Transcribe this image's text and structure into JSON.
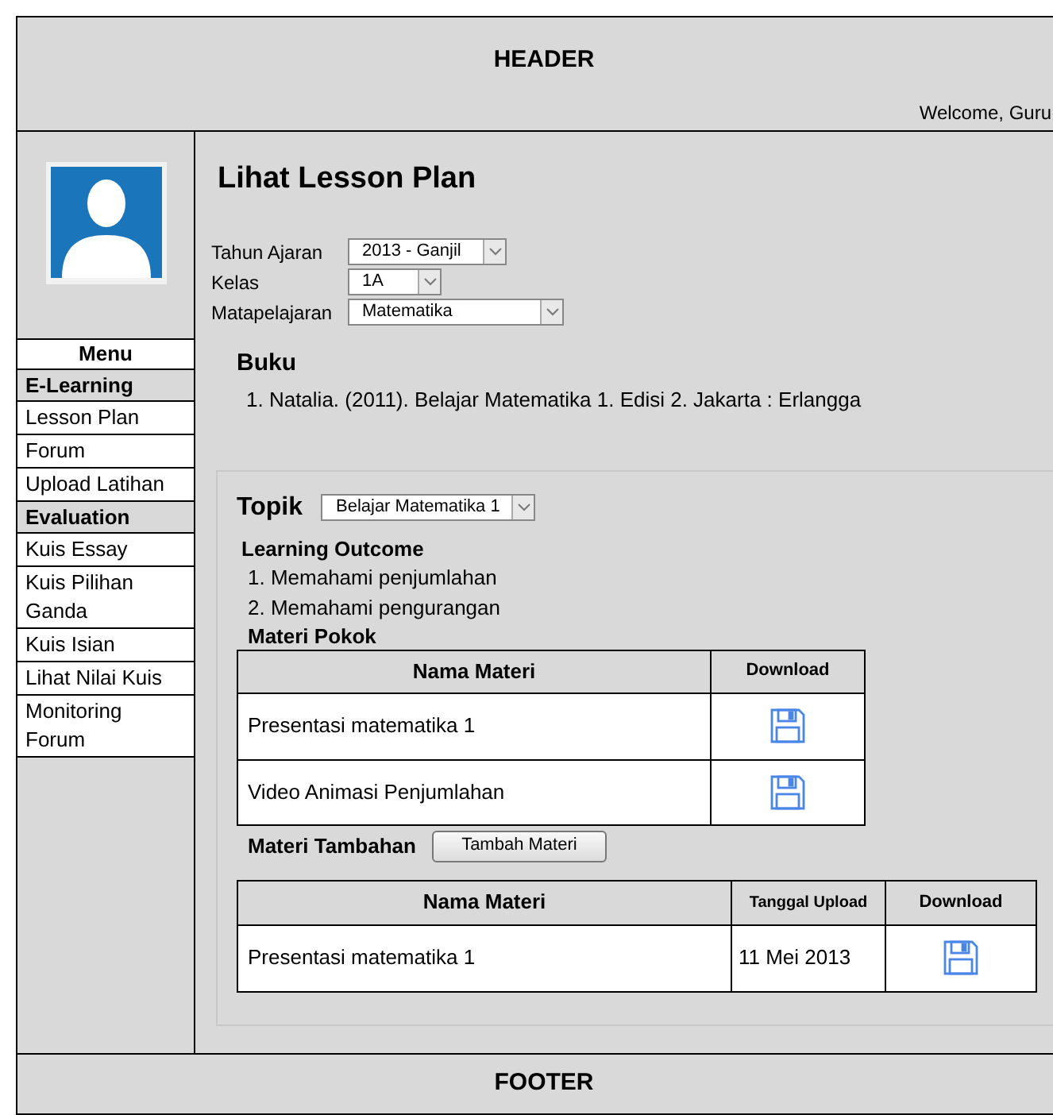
{
  "header": {
    "title": "HEADER",
    "welcome": "Welcome, Guru"
  },
  "sidebar": {
    "menu_title": "Menu",
    "items": [
      {
        "kind": "section",
        "label": "E-Learning"
      },
      {
        "kind": "link",
        "label": "Lesson Plan"
      },
      {
        "kind": "link",
        "label": "Forum"
      },
      {
        "kind": "link",
        "label": "Upload Latihan"
      },
      {
        "kind": "section",
        "label": "Evaluation"
      },
      {
        "kind": "link",
        "label": "Kuis Essay"
      },
      {
        "kind": "link",
        "label": "Kuis Pilihan Ganda"
      },
      {
        "kind": "link",
        "label": "Kuis Isian"
      },
      {
        "kind": "link",
        "label": "Lihat Nilai Kuis"
      },
      {
        "kind": "link",
        "label": "Monitoring Forum"
      }
    ]
  },
  "page_title": "Lihat Lesson Plan",
  "filters": [
    {
      "label": "Tahun Ajaran",
      "value": "2013 - Ganjil"
    },
    {
      "label": "Kelas",
      "value": "1A"
    },
    {
      "label": "Matapelajaran",
      "value": "Matematika"
    }
  ],
  "buku": {
    "title": "Buku",
    "items": [
      "1. Natalia. (2011). Belajar Matematika 1. Edisi 2. Jakarta : Erlangga"
    ]
  },
  "topik": {
    "label": "Topik",
    "value": "Belajar Matematika 1"
  },
  "learning_outcome": {
    "title": "Learning Outcome",
    "items": [
      "1. Memahami penjumlahan",
      "2. Memahami pengurangan"
    ]
  },
  "materi_pokok": {
    "title": "Materi Pokok",
    "columns": [
      "Nama Materi",
      "Download"
    ],
    "rows": [
      {
        "nama": "Presentasi matematika 1"
      },
      {
        "nama": "Video Animasi Penjumlahan"
      }
    ]
  },
  "materi_tambahan": {
    "title": "Materi Tambahan",
    "button": "Tambah Materi",
    "columns": [
      "Nama Materi",
      "Tanggal Upload",
      "Download"
    ],
    "rows": [
      {
        "nama": "Presentasi matematika 1",
        "tanggal": "11 Mei 2013"
      }
    ]
  },
  "footer": {
    "title": "FOOTER"
  }
}
